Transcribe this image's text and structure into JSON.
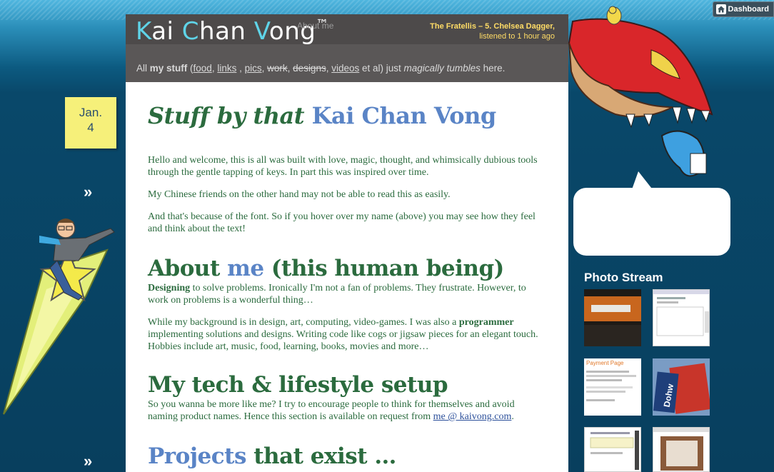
{
  "dashboard": {
    "label": "Dashboard"
  },
  "date": {
    "month": "Jan.",
    "day": "4"
  },
  "nav": {
    "raquo": "»"
  },
  "header": {
    "title_parts": [
      "K",
      "ai ",
      "C",
      "han ",
      "V",
      "ong",
      "™"
    ],
    "ghost_link": "About me",
    "now_playing": "The Fratellis – 5. Chelsea Dagger,",
    "listened": "listened to 1 hour ago"
  },
  "tagline": {
    "prefix": "All ",
    "my_stuff": "my stuff",
    "open": " (",
    "food": "food",
    "c1": ", ",
    "links": "links",
    "c2": " , ",
    "pics": "pics",
    "c3": ", ",
    "work": "work",
    "c4": ", ",
    "designs": "designs",
    "c5": ", ",
    "videos": "videos",
    "mid": " et al) just ",
    "magic": "magically tumbles",
    "suffix": " here."
  },
  "content": {
    "h1_a": "Stuff by that ",
    "h1_b": "Kai Chan Vong",
    "p1": "Hello and welcome, this is all was built with love, magic, thought, and whimsically dubious tools through the gentle tapping of keys. In part this was inspired over time.",
    "p2": "My Chinese friends on the other hand may not be able to read this as easily.",
    "p3": "And that's because of the font. So if you hover over my name (above) you may see how they feel and think about the text!",
    "h2_about_a": "About ",
    "h2_about_b": "me",
    "h2_about_c": " (this human being)",
    "p4_bold": "Designing",
    "p4_rest": " to solve problems. Ironically I'm not a fan of problems. They frustrate. However, to work on problems is a wonderful thing…",
    "p5_a": "While my background is in design, art, computing, video-games. I was also a ",
    "p5_bold": "programmer",
    "p5_b": " implementing solutions and designs. Writing code like cogs or jigsaw pieces for an elegant touch. Hobbies include art, music, food, learning, books, movies and more…",
    "h2_tech": "My tech & lifestyle setup",
    "p6_a": "So you wanna be more like me? I try to encourage people to think for themselves and avoid naming product names. Hence this section is available on request from ",
    "p6_link": "me @ kaivong.com",
    "p6_b": ".",
    "h2_proj_a": "Projects",
    "h2_proj_b": " that exist …"
  },
  "sidebar": {
    "photo_stream": "Photo Stream",
    "thumb3_text": "Payment Page",
    "thumb4_text": "Dohw"
  },
  "colors": {
    "green": "#2b6b3e",
    "blue": "#5a84c6",
    "header": "#4d4a4a",
    "accent_yellow": "#ffdc66"
  }
}
